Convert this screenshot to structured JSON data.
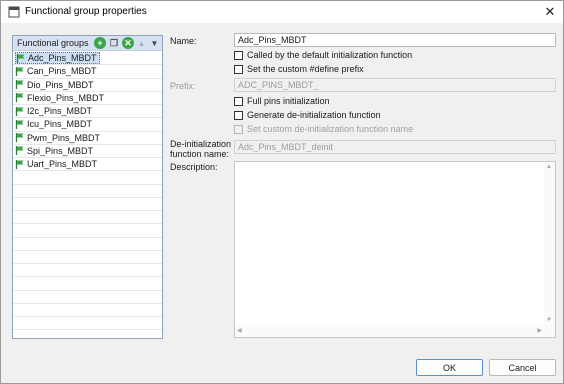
{
  "window": {
    "title": "Functional group properties",
    "close_symbol": "✕"
  },
  "left_panel": {
    "header": "Functional groups",
    "toolbar": {
      "add": "+",
      "copy": "❐",
      "delete": "✕",
      "up": "▲",
      "down": "▼"
    },
    "items": [
      {
        "label": "Adc_Pins_MBDT",
        "selected": true
      },
      {
        "label": "Can_Pins_MBDT"
      },
      {
        "label": "Dio_Pins_MBDT"
      },
      {
        "label": "Flexio_Pins_MBDT"
      },
      {
        "label": "I2c_Pins_MBDT"
      },
      {
        "label": "Icu_Pins_MBDT"
      },
      {
        "label": "Pwm_Pins_MBDT"
      },
      {
        "label": "Spi_Pins_MBDT"
      },
      {
        "label": "Uart_Pins_MBDT"
      }
    ]
  },
  "form": {
    "name_label": "Name:",
    "name_value": "Adc_Pins_MBDT",
    "called_default_init": "Called by the default initialization function",
    "set_custom_define": "Set the custom #define prefix",
    "prefix_label": "Prefix:",
    "prefix_value": "ADC_PINS_MBDT_",
    "full_pins_init": "Full pins initialization",
    "generate_deinit": "Generate de-initialization function",
    "set_custom_deinit_name": "Set custom de-initialization function name",
    "deinit_label_line1": "De-initialization",
    "deinit_label_line2": "function name:",
    "deinit_value": "Adc_Pins_MBDT_deinit",
    "description_label": "Description:",
    "description_value": ""
  },
  "buttons": {
    "ok": "OK",
    "cancel": "Cancel"
  }
}
